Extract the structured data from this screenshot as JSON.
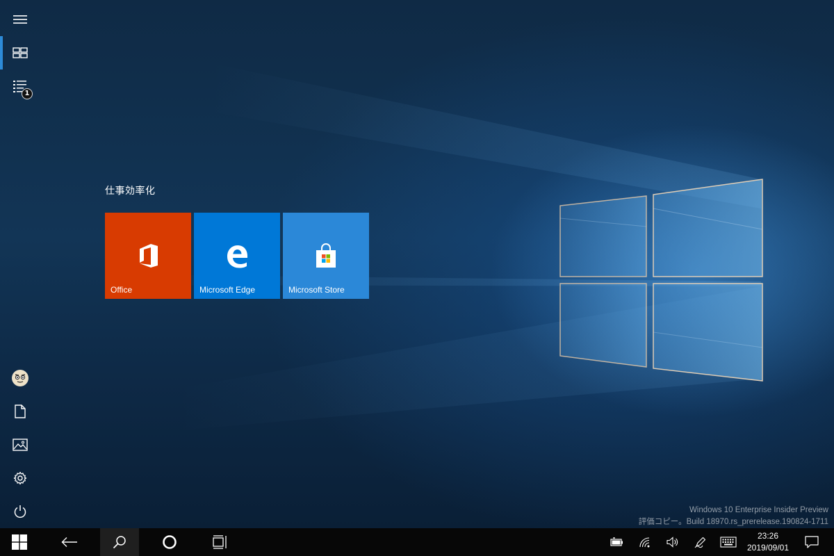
{
  "start": {
    "group_title": "仕事効率化",
    "tiles": [
      {
        "label": "Office",
        "color": "#d83b01",
        "icon": "office-icon"
      },
      {
        "label": "Microsoft Edge",
        "color": "#0078d7",
        "icon": "edge-icon"
      },
      {
        "label": "Microsoft Store",
        "color": "#2b88d8",
        "icon": "store-icon"
      }
    ]
  },
  "rail": {
    "items": [
      {
        "icon": "hamburger-menu-icon"
      },
      {
        "icon": "pinned-tiles-icon",
        "active": true
      },
      {
        "icon": "all-apps-list-icon",
        "badge": "1"
      },
      {
        "icon": "user-avatar"
      },
      {
        "icon": "documents-icon"
      },
      {
        "icon": "pictures-icon"
      },
      {
        "icon": "settings-gear-icon"
      },
      {
        "icon": "power-icon"
      }
    ]
  },
  "watermark": {
    "line1": "Windows 10 Enterprise Insider Preview",
    "line2": "評価コピー。Build 18970.rs_prerelease.190824-1711"
  },
  "taskbar": {
    "buttons": [
      "start-windows-icon",
      "back-arrow-icon",
      "search-icon",
      "cortana-icon",
      "task-view-icon"
    ],
    "tray": [
      "battery-icon",
      "wifi-icon",
      "volume-icon",
      "pen-icon",
      "touch-keyboard-icon",
      "action-center-icon"
    ],
    "time": "23:26",
    "date": "2019/09/01"
  },
  "colors": {
    "accent": "#2d8bd8",
    "taskbar": "#070707"
  }
}
